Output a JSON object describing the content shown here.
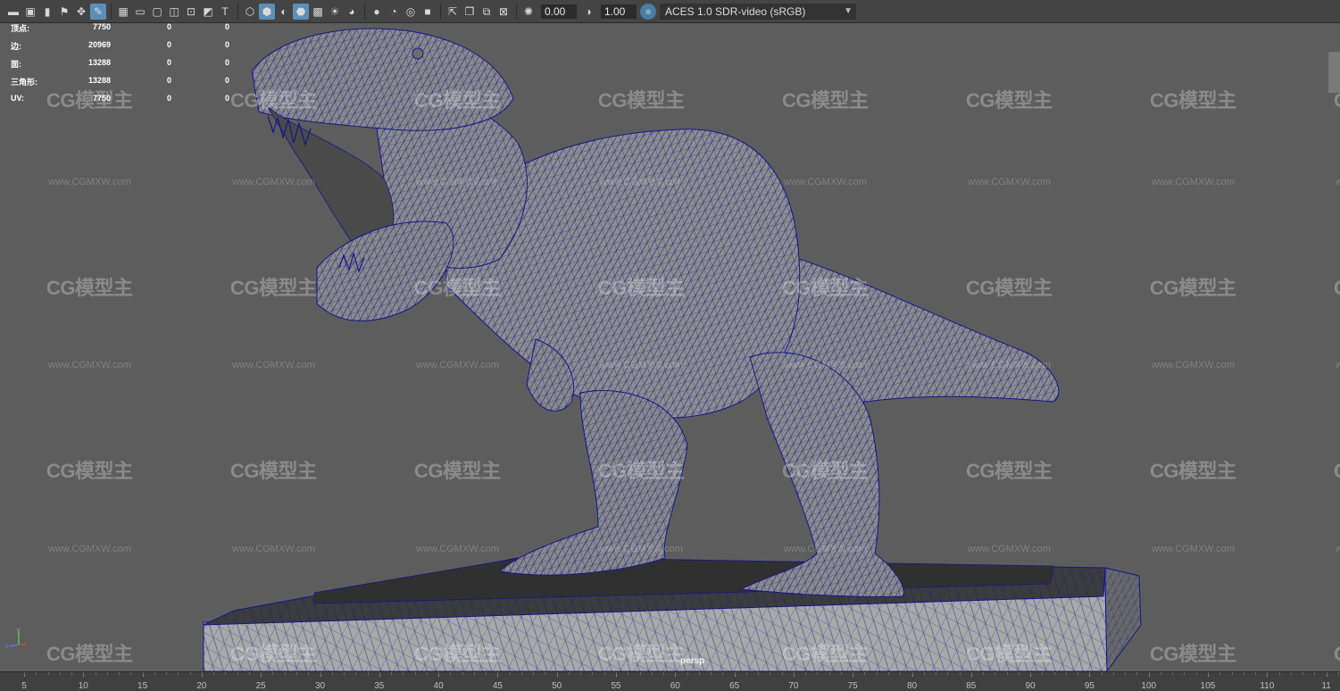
{
  "toolbar": {
    "groups": [
      [
        "camera-icon",
        "camera-attr-icon",
        "bookmark-icon",
        "bookmark-flag-icon",
        "pan-icon",
        "grease-pencil-icon"
      ],
      [
        "grid-icon",
        "film-gate-icon",
        "resolution-gate-icon",
        "gate-mask-icon",
        "field-chart-icon",
        "safe-action-icon",
        "safe-title-icon"
      ],
      [
        "wireframe-icon",
        "smooth-shade-icon",
        "default-material-icon",
        "wireframe-on-shaded-icon",
        "textured-icon",
        "use-lights-icon",
        "shadows-icon"
      ],
      [
        "ssao-icon",
        "motion-blur-icon",
        "multisample-icon",
        "depth-of-field-icon"
      ],
      [
        "isolate-select-icon",
        "xray-icon",
        "xray-joints-icon",
        "xray-components-icon"
      ],
      [
        "exposure-icon"
      ]
    ],
    "active_icons": [
      "grease-pencil-icon",
      "smooth-shade-icon",
      "wireframe-on-shaded-icon"
    ],
    "exposure_value": "0.00",
    "gamma_value": "1.00",
    "color_space": "ACES 1.0 SDR-video (sRGB)"
  },
  "hud": {
    "rows": [
      {
        "label": "顶点:",
        "v1": "7750",
        "v2": "0",
        "v3": "0"
      },
      {
        "label": "边:",
        "v1": "20969",
        "v2": "0",
        "v3": "0"
      },
      {
        "label": "面:",
        "v1": "13288",
        "v2": "0",
        "v3": "0"
      },
      {
        "label": "三角形:",
        "v1": "13288",
        "v2": "0",
        "v3": "0"
      },
      {
        "label": "UV:",
        "v1": "7750",
        "v2": "0",
        "v3": "0"
      }
    ]
  },
  "viewport": {
    "camera_label": "persp",
    "axis_y": "y",
    "axis_z": "z",
    "wire_color": "#16168a",
    "mesh_color": "#8c8c8c",
    "background_color": "#5d5d5d"
  },
  "watermark": {
    "logo_text": "CG模型主",
    "url_text": "www.CGMXW.com"
  },
  "timeline": {
    "labels": [
      "5",
      "10",
      "15",
      "20",
      "25",
      "30",
      "35",
      "40",
      "45",
      "50",
      "55",
      "60",
      "65",
      "70",
      "75",
      "80",
      "85",
      "90",
      "95",
      "100",
      "105",
      "110",
      "11"
    ]
  }
}
